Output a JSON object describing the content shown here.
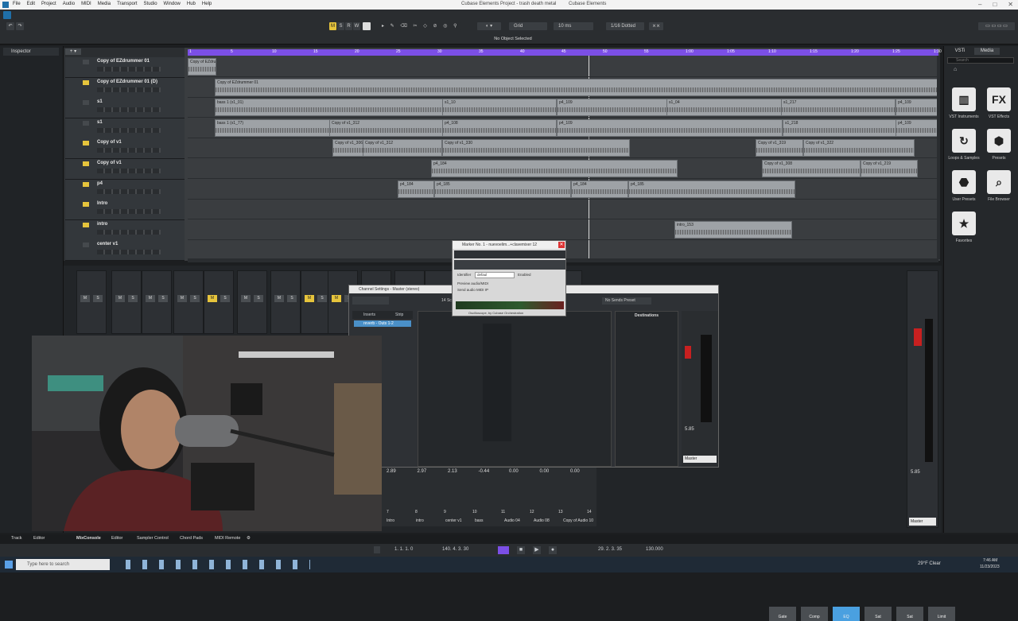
{
  "window": {
    "title": "Cubase Elements Project - trash death metal",
    "title2": "Cubase Elements",
    "menu": [
      "File",
      "Edit",
      "Project",
      "Audio",
      "MIDI",
      "Media",
      "Transport",
      "Studio",
      "Window",
      "Hub",
      "Help"
    ]
  },
  "toolbar": {
    "status": "No Object Selected",
    "grid_mode": "Grid",
    "grid_value": "10 ms",
    "quantize": "1/16 Dotted",
    "mode_buttons": [
      "M",
      "S",
      "R",
      "W"
    ]
  },
  "inspector": {
    "tab": "Inspector"
  },
  "ruler": {
    "marks": [
      "1",
      "5",
      "10",
      "15",
      "20",
      "25",
      "30",
      "35",
      "40",
      "45",
      "50",
      "55",
      "1:00",
      "1:05",
      "1:10",
      "1:15",
      "1:20",
      "1:25",
      "1:30"
    ]
  },
  "tracks": [
    {
      "name": "Copy of EZdrummer 01",
      "solo": false
    },
    {
      "name": "Copy of EZdrummer 01 (D)",
      "solo": true
    },
    {
      "name": "s1",
      "solo": false
    },
    {
      "name": "s1",
      "solo": false
    },
    {
      "name": "Copy of v1",
      "solo": true
    },
    {
      "name": "Copy of v1",
      "solo": true
    },
    {
      "name": "p4",
      "solo": true
    },
    {
      "name": "Intro",
      "solo": true
    },
    {
      "name": "intro",
      "solo": true
    },
    {
      "name": "center v1",
      "solo": false
    }
  ],
  "clips": [
    {
      "label": "Copy of EZdrum"
    },
    {
      "label": "Copy of EZdrummer 01"
    },
    {
      "label": "bass 1 (x1_01)"
    },
    {
      "label": "s1_10"
    },
    {
      "label": "p4_109"
    },
    {
      "label": "s1_04"
    },
    {
      "label": "s1_217"
    },
    {
      "label": "p4_109"
    },
    {
      "label": "bass 1 (x1_77)"
    },
    {
      "label": "Copy of v1_312"
    },
    {
      "label": "p4_108"
    },
    {
      "label": "p4_109"
    },
    {
      "label": "s1_218"
    },
    {
      "label": "p4_109"
    },
    {
      "label": "Copy of v1_306"
    },
    {
      "label": "Copy of v1_312"
    },
    {
      "label": "Copy of v1_330"
    },
    {
      "label": "Copy of v1_319"
    },
    {
      "label": "Copy of v1_322"
    },
    {
      "label": "p4_184"
    },
    {
      "label": "Copy of v1_308"
    },
    {
      "label": "Copy of v1_219"
    },
    {
      "label": "p4_184"
    },
    {
      "label": "p4_185"
    },
    {
      "label": "p4_184"
    },
    {
      "label": "p4_185"
    },
    {
      "label": "intro_153"
    }
  ],
  "media": {
    "tabs": [
      "VSTi",
      "Media"
    ],
    "search_placeholder": "Search",
    "items": [
      {
        "icon": "piano-icon",
        "glyph": "▥",
        "label": "VST Instruments"
      },
      {
        "icon": "fx-icon",
        "glyph": "FX",
        "label": "VST Effects"
      },
      {
        "icon": "loop-icon",
        "glyph": "↻",
        "label": "Loops & Samples"
      },
      {
        "icon": "presets-icon",
        "glyph": "⬢",
        "label": "Presets"
      },
      {
        "icon": "user-presets-icon",
        "glyph": "⬣",
        "label": "User Presets"
      },
      {
        "icon": "file-browser-icon",
        "glyph": "⌕",
        "label": "File Browser"
      },
      {
        "icon": "star-icon",
        "glyph": "★",
        "label": "Favorites"
      }
    ]
  },
  "marker_dialog": {
    "title": "Marker No. 1 - nuevoelim...+clavemixer 12",
    "identifier_label": "Identifier",
    "identifier_value": "defaul",
    "enabled_label": "Enabled",
    "option1": "Preview audio/MIDI",
    "option2": "Send audio MIDI IP",
    "footer": "Oscilloscope, by Cubase Orchestration"
  },
  "channel_settings": {
    "title": "Channel Settings - Master (stereo)",
    "tabs": [
      "Inserts",
      "Strip"
    ],
    "insert": "reverb - Outs 1-2",
    "destinations": "Destinations",
    "field": "14 Sci",
    "search": "No Sends Preset",
    "eq_modules": [
      "Gate",
      "Comp",
      "EQ",
      "Sat",
      "Sat",
      "Limit"
    ],
    "master_label": "Master"
  },
  "mixer": {
    "db_values": [
      "2.89",
      "2.97",
      "2.13",
      "-0.44",
      "0.00",
      "0.00",
      "0.00"
    ],
    "channel_numbers": [
      "7",
      "8",
      "9",
      "10",
      "11",
      "12",
      "13",
      "14"
    ],
    "channel_names": [
      "Intro",
      "intro",
      "center v1",
      "bass",
      "Audio 04",
      "Audio 08",
      "Copy of Audio 10"
    ],
    "master_db": "5.85",
    "master_db2": "5.85",
    "master_label": "Master",
    "master_label2": "Master"
  },
  "bottom_tabs": [
    "Track",
    "Editor",
    "MixConsole",
    "Editor",
    "Sampler Control",
    "Chord Pads",
    "MIDI Remote"
  ],
  "transport": {
    "left_locator": "1. 1. 1. 0",
    "right_locator": "140. 4. 3. 30",
    "position": "29. 2. 3. 35",
    "tempo": "130.000"
  },
  "taskbar": {
    "search_placeholder": "Type here to search",
    "weather": "29°F  Clear",
    "time": "7:46 AM",
    "date": "11/23/2023"
  }
}
